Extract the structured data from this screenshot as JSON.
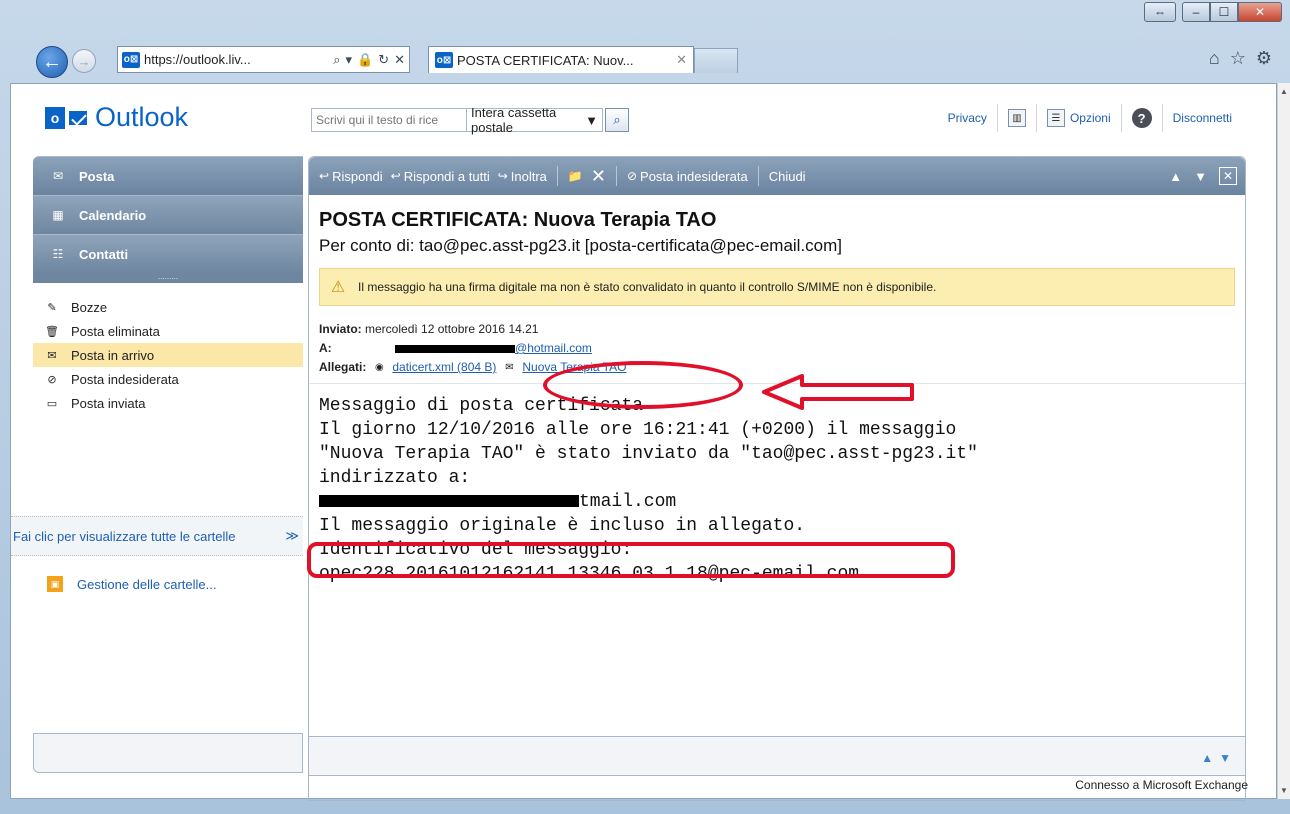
{
  "browser": {
    "address_url": "https://outlook.liv...",
    "tab_title": "POSTA CERTIFICATA: Nuov...",
    "ol_icon": "o⊠"
  },
  "header": {
    "brand": "Outlook",
    "search_placeholder": "Scrivi qui il testo di rice",
    "scope": "Intera cassetta postale",
    "links": {
      "privacy": "Privacy",
      "options": "Opzioni",
      "logout": "Disconnetti"
    }
  },
  "nav": {
    "buttons": [
      "Posta",
      "Calendario",
      "Contatti"
    ],
    "folders": [
      "Bozze",
      "Posta eliminata",
      "Posta in arrivo",
      "Posta indesiderata",
      "Posta inviata"
    ],
    "active_folder": "Posta in arrivo",
    "all_folders": "Fai clic per visualizzare tutte le cartelle",
    "manage": "Gestione delle cartelle..."
  },
  "toolbar": {
    "reply": "Rispondi",
    "reply_all": "Rispondi a tutti",
    "forward": "Inoltra",
    "junk": "Posta indesiderata",
    "close": "Chiudi"
  },
  "message": {
    "subject": "POSTA CERTIFICATA: Nuova Terapia TAO",
    "on_behalf": "Per conto di: tao@pec.asst-pg23.it [posta-certificata@pec-email.com]",
    "warning": "Il messaggio ha una firma digitale ma non è stato convalidato in quanto il controllo S/MIME non è disponibile.",
    "sent_label": "Inviato:",
    "sent_value": "mercoledì 12 ottobre 2016 14.21",
    "to_label": "A:",
    "to_value": "@hotmail.com",
    "att_label": "Allegati:",
    "att1": "daticert.xml (804 B)",
    "att2": "Nuova Terapia TAO",
    "body_lines": [
      "Messaggio di posta certificata",
      "Il giorno 12/10/2016 alle ore 16:21:41 (+0200) il messaggio",
      "\"Nuova Terapia TAO\" è stato inviato da \"tao@pec.asst-pg23.it\"",
      "indirizzato a:",
      "tmail.com",
      "Il messaggio originale è incluso in allegato.",
      "Identificativo del messaggio:",
      "opec228.20161012162141.13346.03.1.18@pec-email.com"
    ]
  },
  "status": "Connesso a Microsoft Exchange"
}
